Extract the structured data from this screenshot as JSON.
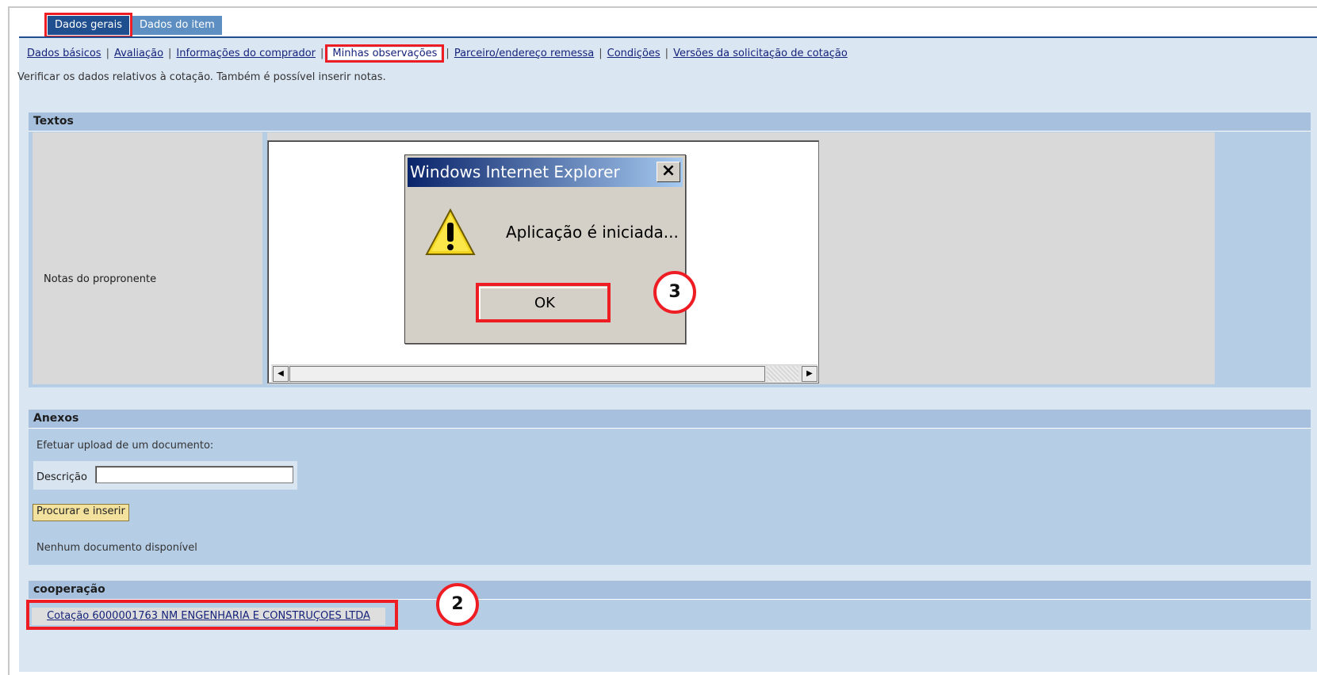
{
  "tabs": {
    "general": "Dados gerais",
    "item": "Dados do item"
  },
  "subnav": {
    "items": [
      "Dados básicos",
      "Avaliação",
      "Informações do comprador",
      "Minhas observações",
      "Parceiro/endereço remessa",
      "Condições",
      "Versões da solicitação de cotação"
    ],
    "separator": "|"
  },
  "description": "Verificar os dados relativos à cotação. Também é possível inserir notas.",
  "textos": {
    "title": "Textos",
    "notes_label": "Notas do propronente"
  },
  "dialog": {
    "title": "Windows Internet Explorer",
    "message": "Aplicação é iniciada...",
    "ok_label": "OK",
    "icon": "warning-icon",
    "close_symbol": "×"
  },
  "anexos": {
    "title": "Anexos",
    "upload_label": "Efetuar upload de um documento:",
    "description_label": "Descrição",
    "description_value": "",
    "browse_button": "Procurar e inserir",
    "no_docs": "Nenhum documento disponível"
  },
  "cooperacao": {
    "title": "cooperação",
    "link": "Cotação 6000001763 NM ENGENHARIA E CONSTRUÇOES LTDA"
  },
  "callouts": {
    "ok_step": "3",
    "link_step": "2"
  },
  "colors": {
    "highlight": "#ee1d23",
    "tab_active": "#1f4f8e",
    "tab_inactive": "#5d8fc2",
    "panel": "#dbe6f3",
    "group": "#b6cde6"
  }
}
